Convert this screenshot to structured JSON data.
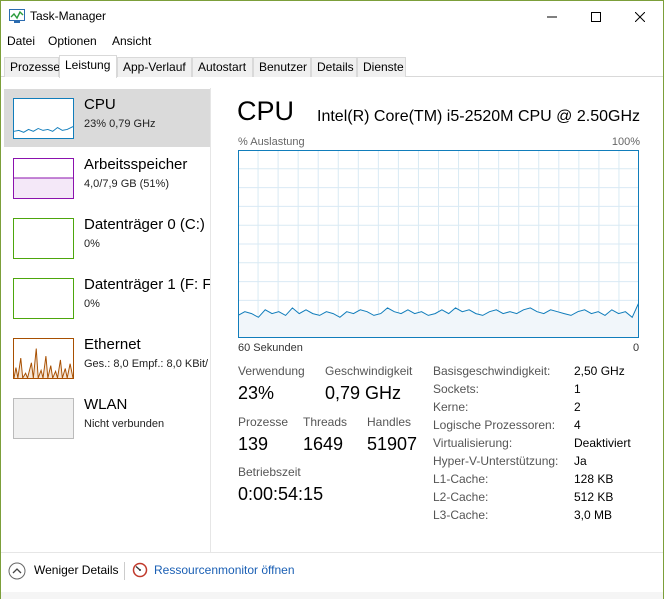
{
  "window": {
    "title": "Task-Manager"
  },
  "menu": {
    "items": [
      "Datei",
      "Optionen",
      "Ansicht"
    ]
  },
  "tabs": [
    "Prozesse",
    "Leistung",
    "App-Verlauf",
    "Autostart",
    "Benutzer",
    "Details",
    "Dienste"
  ],
  "active_tab": "Leistung",
  "sidebar": {
    "items": [
      {
        "title": "CPU",
        "subtitle": "23% 0,79 GHz",
        "color": "#117dbb"
      },
      {
        "title": "Arbeitsspeicher",
        "subtitle": "4,0/7,9 GB (51%)",
        "color": "#8b12ae"
      },
      {
        "title": "Datenträger 0 (C:)",
        "subtitle": "0%",
        "color": "#4da60c"
      },
      {
        "title": "Datenträger 1 (F: F",
        "subtitle": "0%",
        "color": "#4da60c"
      },
      {
        "title": "Ethernet",
        "subtitle": "Ges.: 8,0  Empf.: 8,0 KBit/",
        "color": "#a74f01"
      },
      {
        "title": "WLAN",
        "subtitle": "Nicht verbunden",
        "color": "#999999"
      }
    ]
  },
  "main": {
    "heading": "CPU",
    "model": "Intel(R) Core(TM) i5-2520M CPU @ 2.50GHz",
    "util_label": "% Auslastung",
    "pct_max": "100%",
    "time_label": "60 Sekunden",
    "time_zero": "0",
    "stats": {
      "verwendung_label": "Verwendung",
      "verwendung": "23%",
      "geschwindigkeit_label": "Geschwindigkeit",
      "geschwindigkeit": "0,79 GHz",
      "prozesse_label": "Prozesse",
      "prozesse": "139",
      "threads_label": "Threads",
      "threads": "1649",
      "handles_label": "Handles",
      "handles": "51907",
      "betriebszeit_label": "Betriebszeit",
      "betriebszeit": "0:00:54:15"
    },
    "info": [
      {
        "label": "Basisgeschwindigkeit:",
        "value": "2,50 GHz"
      },
      {
        "label": "Sockets:",
        "value": "1"
      },
      {
        "label": "Kerne:",
        "value": "2"
      },
      {
        "label": "Logische Prozessoren:",
        "value": "4"
      },
      {
        "label": "Virtualisierung:",
        "value": "Deaktiviert"
      },
      {
        "label": "Hyper-V-Unterstützung:",
        "value": "Ja"
      },
      {
        "label": "L1-Cache:",
        "value": "128 KB"
      },
      {
        "label": "L2-Cache:",
        "value": "512 KB"
      },
      {
        "label": "L3-Cache:",
        "value": "3,0 MB"
      }
    ],
    "cpu_history_pct": [
      12,
      14,
      13,
      11,
      15,
      13,
      14,
      12,
      16,
      13,
      15,
      13,
      12,
      14,
      13,
      11,
      14,
      13,
      15,
      14,
      12,
      13,
      16,
      14,
      13,
      15,
      13,
      14,
      12,
      13,
      15,
      13,
      16,
      14,
      15,
      13,
      12,
      14,
      15,
      13,
      14,
      13,
      15,
      16,
      14,
      13,
      15,
      14,
      13,
      12,
      14,
      15,
      13,
      14,
      12,
      15,
      13,
      14,
      11,
      19
    ]
  },
  "bottom": {
    "fewer_details": "Weniger Details",
    "resource_monitor": "Ressourcenmonitor öffnen"
  },
  "colors": {
    "cpu_line": "#117dbb",
    "cpu_fill": "#f1f6fa",
    "grid": "#d9eaf4",
    "graph_border": "#117dbb"
  }
}
